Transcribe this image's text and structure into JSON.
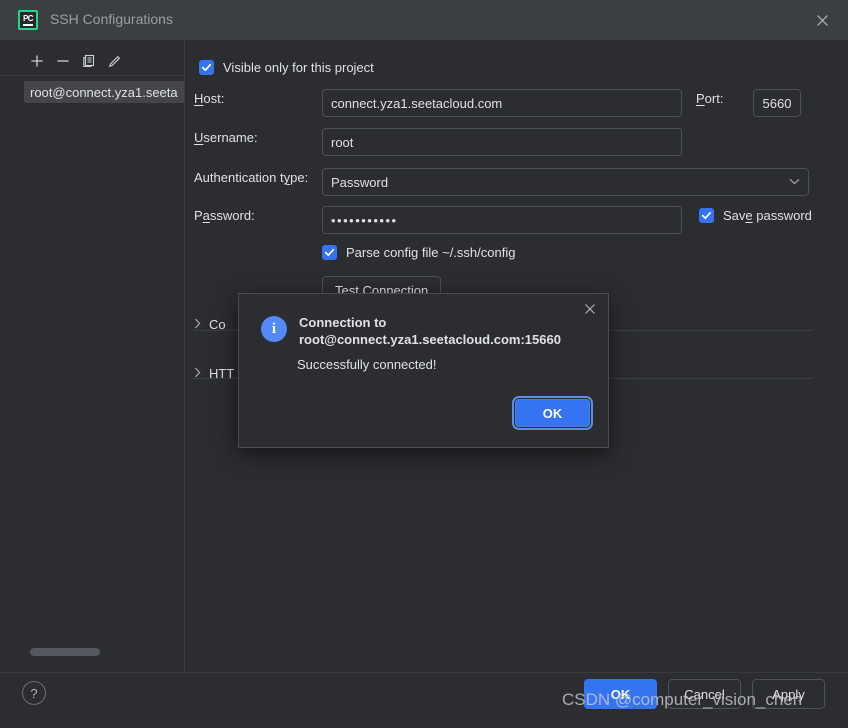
{
  "window": {
    "title": "SSH Configurations",
    "app_icon": "pycharm-logo",
    "app_icon_text": "PC",
    "close_icon": "close-icon"
  },
  "sidebar": {
    "toolbar": [
      {
        "name": "add-configuration-button",
        "icon": "plus-icon"
      },
      {
        "name": "remove-configuration-button",
        "icon": "minus-icon"
      },
      {
        "name": "copy-configuration-button",
        "icon": "copy-icon"
      },
      {
        "name": "edit-configuration-button",
        "icon": "pencil-icon"
      }
    ],
    "items": [
      {
        "label": "root@connect.yza1.seeta",
        "selected": true
      }
    ],
    "scrollbar": "horizontal-scrollbar"
  },
  "form": {
    "visible_only_checkbox": {
      "label": "Visible only for this project",
      "checked": true
    },
    "host": {
      "label": "Host:",
      "mnemonic": "H",
      "value": "connect.yza1.seetacloud.com"
    },
    "port": {
      "label": "Port:",
      "mnemonic": "P",
      "value": "5660"
    },
    "username": {
      "label": "Username:",
      "mnemonic": "U",
      "value": "root"
    },
    "auth_type": {
      "label": "Authentication type:",
      "mnemonic": "y",
      "value": "Password",
      "chevron": "chevron-down-icon"
    },
    "password": {
      "label": "Password:",
      "mnemonic": "a",
      "value": "•••••••••••"
    },
    "save_password": {
      "label": "Save password",
      "mnemonic": "e",
      "checked": true
    },
    "parse_config": {
      "label": "Parse config file ~/.ssh/config",
      "checked": true
    },
    "test_connection_button": {
      "label": "Test Connection",
      "mnemonic": "C"
    },
    "sections": [
      {
        "label": "Co",
        "caret": "chevron-right-icon"
      },
      {
        "label": "HTT",
        "caret": "chevron-right-icon"
      }
    ]
  },
  "modal": {
    "icon": "info-icon",
    "icon_glyph": "i",
    "title_line1": "Connection to",
    "title_line2": "root@connect.yza1.seetacloud.com:15660",
    "message": "Successfully connected!",
    "ok_label": "OK",
    "close_icon": "close-icon"
  },
  "footer": {
    "help_label": "?",
    "ok_label": "OK",
    "cancel_label": "Cancel",
    "apply_label": "Apply"
  },
  "watermark": "CSDN @computer_vision_chen",
  "colors": {
    "accent_blue": "#3574f0",
    "info_blue": "#548af7",
    "logo_green": "#21d789",
    "background": "#2b2d30",
    "titlebar": "#3c3f41"
  }
}
